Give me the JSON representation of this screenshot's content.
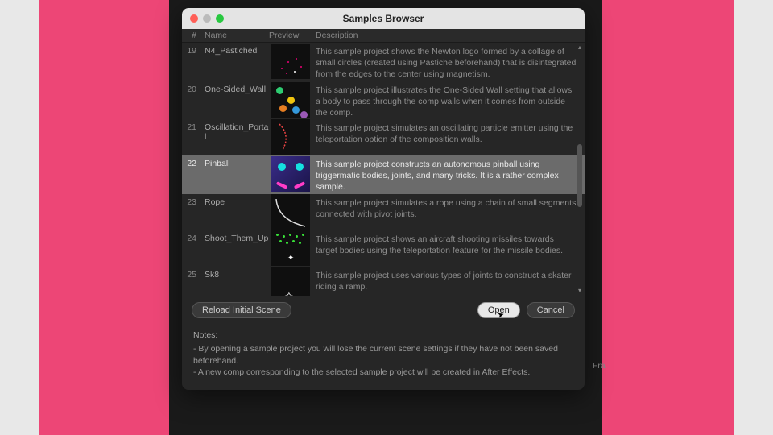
{
  "window": {
    "title": "Samples Browser"
  },
  "columns": {
    "idx": "#",
    "name": "Name",
    "preview": "Preview",
    "desc": "Description"
  },
  "rows": [
    {
      "idx": "19",
      "name": "N4_Pastiched",
      "desc": "This sample project shows the Newton logo formed by a collage of small circles (created using Pastiche beforehand) that is disintegrated from the edges to the center using magnetism.",
      "preview": "particles",
      "selected": false
    },
    {
      "idx": "20",
      "name": "One-Sided_Wall",
      "desc": "This sample project illustrates the One-Sided Wall setting that allows a body to pass through the comp walls when it comes from outside the comp.",
      "preview": "onesided",
      "selected": false
    },
    {
      "idx": "21",
      "name": "Oscillation_Portal",
      "desc": "This sample project simulates an oscillating particle emitter using the teleportation option of the composition walls.",
      "preview": "osc",
      "selected": false
    },
    {
      "idx": "22",
      "name": "Pinball",
      "desc": "This sample project constructs an autonomous pinball using triggermatic bodies, joints, and many tricks. It is a rather complex sample.",
      "preview": "pinball",
      "selected": true
    },
    {
      "idx": "23",
      "name": "Rope",
      "desc": "This sample project simulates a rope using a chain of small segments connected with pivot joints.",
      "preview": "rope",
      "selected": false
    },
    {
      "idx": "24",
      "name": "Shoot_Them_Up",
      "desc": "This sample project shows an aircraft shooting missiles towards target bodies using the teleportation feature for the missile bodies.",
      "preview": "shoot",
      "selected": false
    },
    {
      "idx": "25",
      "name": "Sk8",
      "desc": "This sample project uses various types of joints to construct a skater riding a ramp.",
      "preview": "sk8",
      "selected": false
    }
  ],
  "buttons": {
    "reload": "Reload Initial Scene",
    "open": "Open",
    "cancel": "Cancel"
  },
  "notes": {
    "title": "Notes:",
    "line1": "- By opening a sample project you will lose the current scene settings if they have not been saved beforehand.",
    "line2": "- A new comp corresponding to the selected sample project will be created in After Effects."
  },
  "background": {
    "label": "Fra"
  }
}
